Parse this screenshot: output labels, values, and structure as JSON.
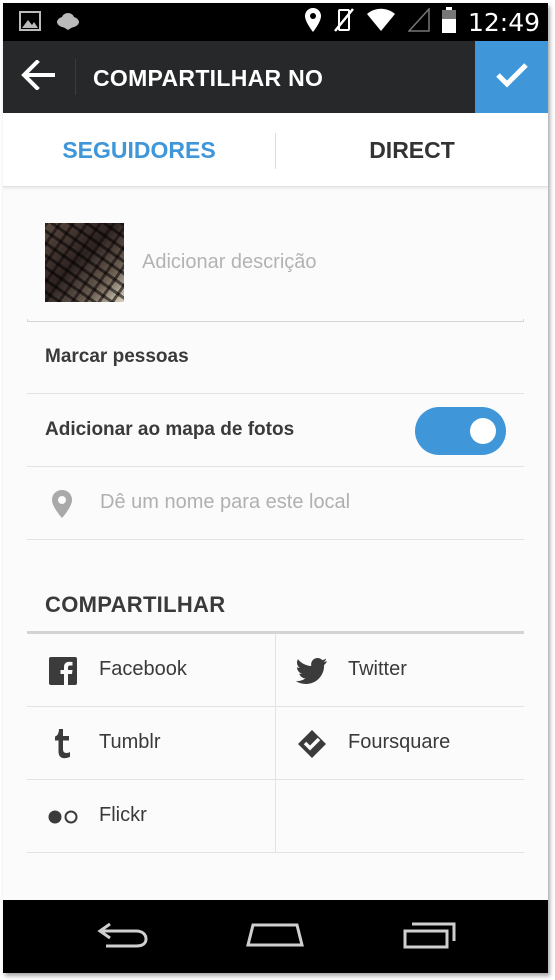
{
  "status_bar": {
    "time": "12:49",
    "icons": [
      "image-icon",
      "cloud-icon",
      "location-icon",
      "vibrate-off-icon",
      "wifi-icon",
      "signal-icon",
      "battery-icon"
    ]
  },
  "toolbar": {
    "title": "COMPARTILHAR NO",
    "back_icon": "arrow-left-icon",
    "confirm_icon": "check-icon",
    "accent_color": "#3f96d8"
  },
  "tabs": [
    {
      "label": "SEGUIDORES",
      "active": true
    },
    {
      "label": "DIRECT",
      "active": false
    }
  ],
  "caption": {
    "placeholder": "Adicionar descrição",
    "value": ""
  },
  "tag_people": {
    "label": "Marcar pessoas"
  },
  "photo_map": {
    "label": "Adicionar ao mapa de fotos",
    "enabled": true
  },
  "location": {
    "placeholder": "Dê um nome para este local",
    "icon": "location-pin-icon"
  },
  "share": {
    "header": "COMPARTILHAR",
    "services": [
      {
        "label": "Facebook",
        "icon": "facebook-icon"
      },
      {
        "label": "Twitter",
        "icon": "twitter-icon"
      },
      {
        "label": "Tumblr",
        "icon": "tumblr-icon"
      },
      {
        "label": "Foursquare",
        "icon": "foursquare-icon"
      },
      {
        "label": "Flickr",
        "icon": "flickr-icon"
      }
    ]
  },
  "nav_bar": {
    "buttons": [
      "back-nav-icon",
      "home-nav-icon",
      "recents-nav-icon"
    ]
  }
}
